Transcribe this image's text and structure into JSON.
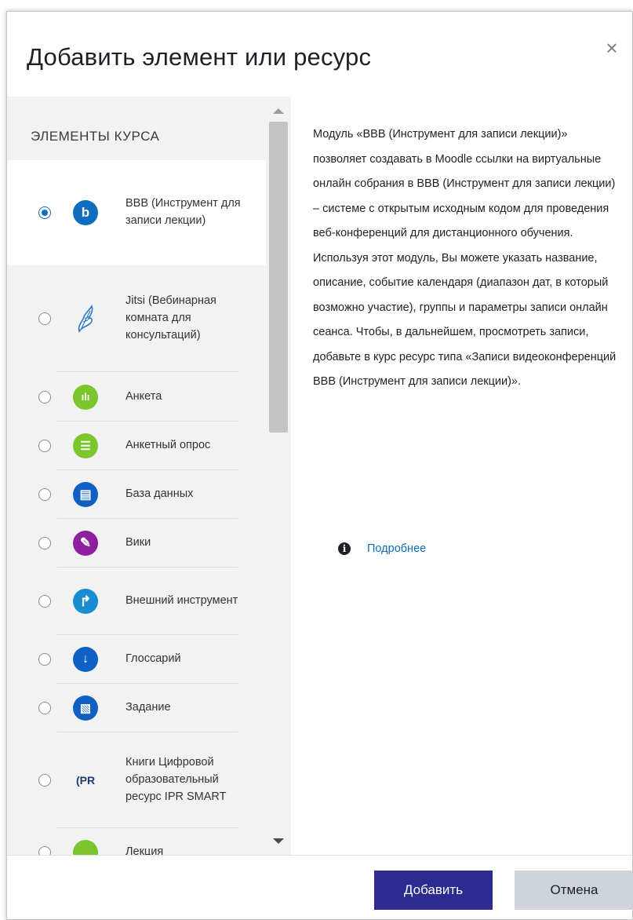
{
  "modal": {
    "title": "Добавить элемент или ресурс",
    "close_symbol": "×"
  },
  "left": {
    "section_title": "ЭЛЕМЕНТЫ КУРСА",
    "items": [
      {
        "label": "BBB (Инструмент для записи лекции)",
        "icon": "bigbluebutton-icon",
        "glyph": "b",
        "color": "#0f6cbf",
        "selected": true
      },
      {
        "label": "Jitsi (Вебинарная комната для консультаций)",
        "icon": "jitsi-icon",
        "glyph": "",
        "color": "",
        "selected": false
      },
      {
        "label": "Анкета",
        "icon": "feedback-icon",
        "glyph": "ılı",
        "color": "#7bc62d",
        "selected": false
      },
      {
        "label": "Анкетный опрос",
        "icon": "survey-icon",
        "glyph": "☰",
        "color": "#7bc62d",
        "selected": false
      },
      {
        "label": "База данных",
        "icon": "database-icon",
        "glyph": "▤",
        "color": "#0f5fc5",
        "selected": false
      },
      {
        "label": "Вики",
        "icon": "wiki-icon",
        "glyph": "✎",
        "color": "#8e1f9f",
        "selected": false
      },
      {
        "label": "Внешний инструмент",
        "icon": "external-tool-icon",
        "glyph": "↱",
        "color": "#1a8dd0",
        "selected": false
      },
      {
        "label": "Глоссарий",
        "icon": "glossary-icon",
        "glyph": "↓",
        "color": "#0f5fc5",
        "selected": false
      },
      {
        "label": "Задание",
        "icon": "assignment-icon",
        "glyph": "▧",
        "color": "#0f5fc5",
        "selected": false
      },
      {
        "label": "Книги Цифровой образовательный ресурс IPR SMART",
        "icon": "ipr-smart-icon",
        "glyph": "(PR",
        "color": "",
        "selected": false
      },
      {
        "label": "Лекция",
        "icon": "lesson-icon",
        "glyph": "",
        "color": "#7bc62d",
        "selected": false
      }
    ]
  },
  "right": {
    "description": "Модуль «BBB (Инструмент для записи лекции)» позволяет создавать в Moodle ссылки на виртуальные онлайн собрания в BBB (Инструмент для записи лекции) – системе с открытым исходным кодом для проведения веб-конференций для дистанционного обучения. Используя этот модуль, Вы можете указать название, описание, событие календаря (диапазон дат, в который возможно участие), группы и параметры записи онлайн сеанса. Чтобы, в дальнейшем, просмотреть записи, добавьте в курс ресурс типа «Записи видеоконференций BBB (Инструмент для записи лекции)».",
    "more_link": "Подробнее",
    "info_glyph": "i"
  },
  "footer": {
    "add_label": "Добавить",
    "cancel_label": "Отмена"
  },
  "colors": {
    "primary": "#2d2b91",
    "link": "#0f6cbf",
    "secondary": "#ced4da"
  }
}
